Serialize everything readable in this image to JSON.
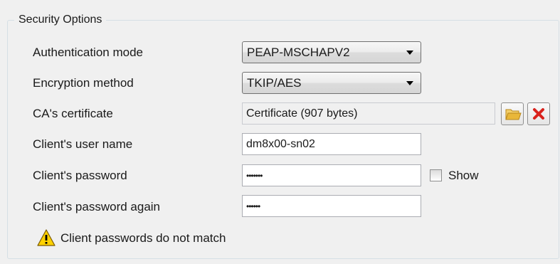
{
  "group": {
    "title": "Security Options"
  },
  "rows": {
    "auth_mode": {
      "label": "Authentication mode",
      "value": "PEAP-MSCHAPV2"
    },
    "encryption": {
      "label": "Encryption method",
      "value": "TKIP/AES"
    },
    "ca_cert": {
      "label": "CA's certificate",
      "value": "Certificate (907 bytes)"
    },
    "user_name": {
      "label": "Client's user name",
      "value": "dm8x00-sn02"
    },
    "password": {
      "label": "Client's password",
      "value": "•••••••"
    },
    "password_again": {
      "label": "Client's password again",
      "value": "••••••"
    }
  },
  "show_checkbox": {
    "label": "Show",
    "checked": false
  },
  "icons": {
    "browse": "folder-open-icon",
    "clear": "red-x-icon",
    "warning": "warning-triangle-icon"
  },
  "warning": {
    "text": "Client passwords do not match"
  },
  "colors": {
    "clear_x": "#d9221c",
    "warning_fill": "#ffd200",
    "folder": "#e9b73a"
  }
}
